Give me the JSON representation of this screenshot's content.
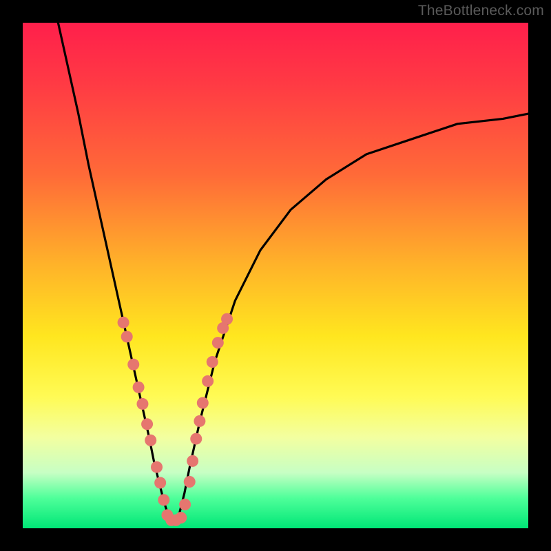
{
  "watermark": "TheBottleneck.com",
  "chart_data": {
    "type": "line",
    "title": "",
    "xlabel": "",
    "ylabel": "",
    "xlim": [
      0,
      100
    ],
    "ylim": [
      0,
      100
    ],
    "grid": false,
    "legend": false,
    "notes": "No axes, ticks, or labels visible. Background is a red-to-green vertical gradient. Two black curves form a V meeting near x≈29. Salmon dots overlay lower parts of both curves.",
    "series": [
      {
        "name": "left-curve",
        "color": "#000000",
        "x": [
          7,
          9,
          11,
          13,
          15,
          17,
          19,
          21,
          23,
          25,
          26,
          27,
          28,
          29,
          30
        ],
        "y": [
          100,
          91,
          82,
          72,
          63,
          54,
          45,
          36,
          27,
          18,
          13,
          9,
          5,
          2,
          1
        ]
      },
      {
        "name": "right-curve",
        "color": "#000000",
        "x": [
          30,
          31,
          32,
          33,
          35,
          38,
          42,
          47,
          53,
          60,
          68,
          77,
          86,
          95,
          100
        ],
        "y": [
          1,
          3,
          7,
          12,
          21,
          33,
          45,
          55,
          63,
          69,
          74,
          77,
          80,
          81,
          82
        ]
      },
      {
        "name": "dots-left",
        "color": "#e6766f",
        "type": "scatter",
        "x": [
          19.9,
          20.6,
          21.9,
          22.9,
          23.7,
          24.6,
          25.3,
          26.5,
          27.2,
          27.9,
          28.6,
          29.4
        ],
        "y": [
          40.7,
          37.9,
          32.4,
          27.9,
          24.6,
          20.6,
          17.4,
          12.1,
          9.0,
          5.6,
          2.6,
          1.6
        ]
      },
      {
        "name": "dots-right",
        "color": "#e6766f",
        "type": "scatter",
        "x": [
          30.3,
          31.3,
          32.1,
          33.0,
          33.6,
          34.3,
          35.0,
          35.6,
          36.6,
          37.5,
          38.6,
          39.6,
          40.4
        ],
        "y": [
          1.6,
          2.1,
          4.7,
          9.2,
          13.3,
          17.7,
          21.2,
          24.8,
          29.1,
          32.9,
          36.7,
          39.6,
          41.4
        ]
      }
    ]
  }
}
